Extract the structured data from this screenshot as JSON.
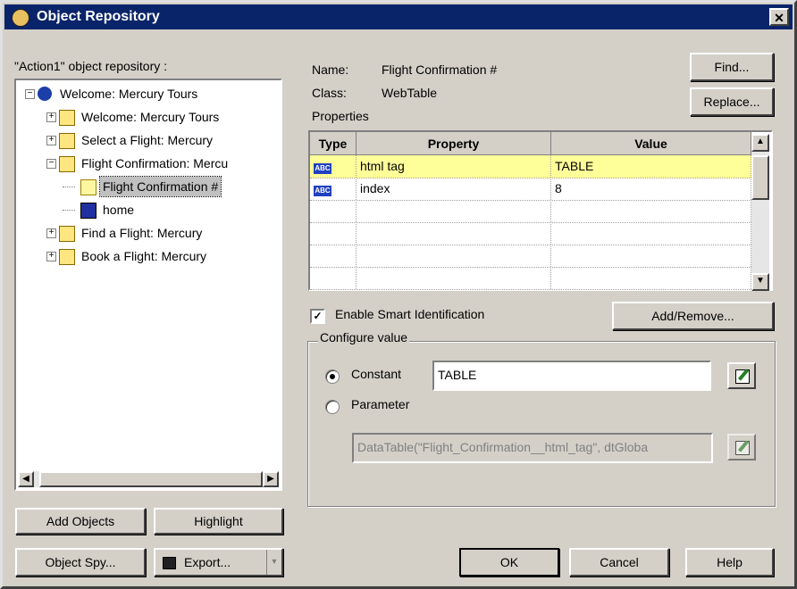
{
  "window": {
    "title": "Object Repository",
    "close_label": "✕"
  },
  "repository_label": "\"Action1\" object repository :",
  "tree": [
    {
      "label": "Welcome: Mercury Tours",
      "level": 0,
      "expander": "−",
      "icon": "globe-icon"
    },
    {
      "label": "Welcome: Mercury Tours",
      "level": 1,
      "expander": "+",
      "icon": "page-icon"
    },
    {
      "label": "Select a Flight: Mercury",
      "level": 1,
      "expander": "+",
      "icon": "page-icon"
    },
    {
      "label": "Flight Confirmation: Mercu",
      "level": 1,
      "expander": "−",
      "icon": "page-icon"
    },
    {
      "label": "Flight Confirmation #",
      "level": 2,
      "expander": "",
      "icon": "table-icon",
      "selected": true
    },
    {
      "label": "home",
      "level": 2,
      "expander": "",
      "icon": "image-icon"
    },
    {
      "label": "Find a Flight: Mercury",
      "level": 1,
      "expander": "+",
      "icon": "page-icon"
    },
    {
      "label": "Book a Flight: Mercury",
      "level": 1,
      "expander": "+",
      "icon": "page-icon"
    }
  ],
  "details": {
    "name_label": "Name:",
    "name_value": "Flight Confirmation #",
    "class_label": "Class:",
    "class_value": "WebTable",
    "properties_label": "Properties"
  },
  "buttons": {
    "find": "Find...",
    "replace": "Replace...",
    "add_remove": "Add/Remove...",
    "add_objects": "Add Objects",
    "highlight": "Highlight",
    "object_spy": "Object Spy...",
    "export": "Export...",
    "ok": "OK",
    "cancel": "Cancel",
    "help": "Help"
  },
  "grid": {
    "headers": [
      "Type",
      "Property",
      "Value"
    ],
    "rows": [
      {
        "type_icon": "ABC",
        "property": "html tag",
        "value": "TABLE",
        "selected": true
      },
      {
        "type_icon": "ABC",
        "property": "index",
        "value": "8"
      },
      {
        "type_icon": "",
        "property": "",
        "value": ""
      },
      {
        "type_icon": "",
        "property": "",
        "value": ""
      },
      {
        "type_icon": "",
        "property": "",
        "value": ""
      },
      {
        "type_icon": "",
        "property": "",
        "value": ""
      }
    ]
  },
  "smart_identification": {
    "label": "Enable Smart Identification",
    "checked": true
  },
  "configure": {
    "legend": "Configure value",
    "constant_label": "Constant",
    "constant_value": "TABLE",
    "parameter_label": "Parameter",
    "parameter_value": "DataTable(\"Flight_Confirmation__html_tag\", dtGloba",
    "selected": "constant"
  },
  "colors": {
    "title_bar": "#0a246a",
    "row_highlight": "#ffff99",
    "dialog_bg": "#d4d0c8"
  }
}
